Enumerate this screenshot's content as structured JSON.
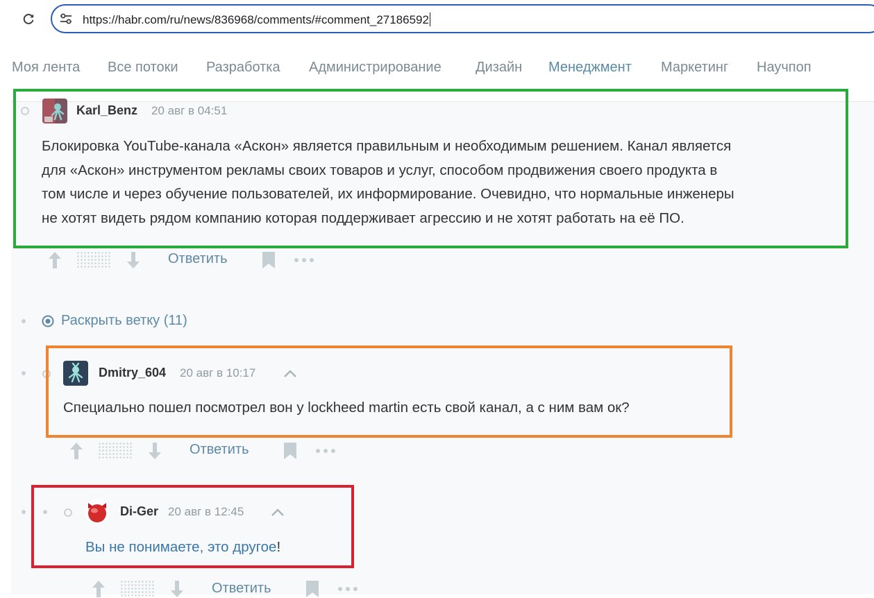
{
  "browser": {
    "url": "https://habr.com/ru/news/836968/comments/#comment_27186592"
  },
  "hub_nav": {
    "tabs": [
      {
        "label": "Моя лента",
        "active": false
      },
      {
        "label": "Все потоки",
        "active": false
      },
      {
        "label": "Разработка",
        "active": false
      },
      {
        "label": "Администрирование",
        "active": false
      },
      {
        "label": "Дизайн",
        "active": false
      },
      {
        "label": "Менеджмент",
        "active": true
      },
      {
        "label": "Маркетинг",
        "active": false
      },
      {
        "label": "Научпоп",
        "active": false
      }
    ]
  },
  "comments": [
    {
      "author": "Karl_Benz",
      "time": "20 авг в 04:51",
      "text_lines": [
        "Блокировка YouTube-канала «Аскон» является правильным и необходимым решением. Канал является",
        "для «Аскон» инструментом рекламы своих товаров и услуг, способом продвижения своего продукта в",
        "том числе и через обучение пользователей, их информирование. Очевидно, что нормальные инженеры",
        "не хотят видеть рядом компанию которая поддерживает агрессию и не хотят работать на её ПО."
      ],
      "reply_label": "Ответить"
    },
    {
      "author": "Dmitry_604",
      "time": "20 авг в 10:17",
      "text_lines": [
        "Специально пошел посмотрел вон у lockheed martin есть свой канал, а с ним вам ок?"
      ],
      "reply_label": "Ответить"
    },
    {
      "author": "Di-Ger",
      "time": "20 авг в 12:45",
      "link_text": "Вы не понимаете, это другое",
      "trailing_text": "!",
      "reply_label": "Ответить"
    }
  ],
  "expand_branch": {
    "label": "Раскрыть ветку (11)"
  },
  "colors": {
    "highlight_green": "#2bab3c",
    "highlight_orange": "#ef8530",
    "highlight_red": "#dd2030",
    "link": "#3a77a8",
    "active_tab": "#5a8aa6"
  },
  "icons": [
    "reload-icon",
    "site-info-icon",
    "vote-up-icon",
    "vote-down-icon",
    "bookmark-icon",
    "more-icon",
    "expand-branch-icon",
    "chevron-up-icon"
  ]
}
